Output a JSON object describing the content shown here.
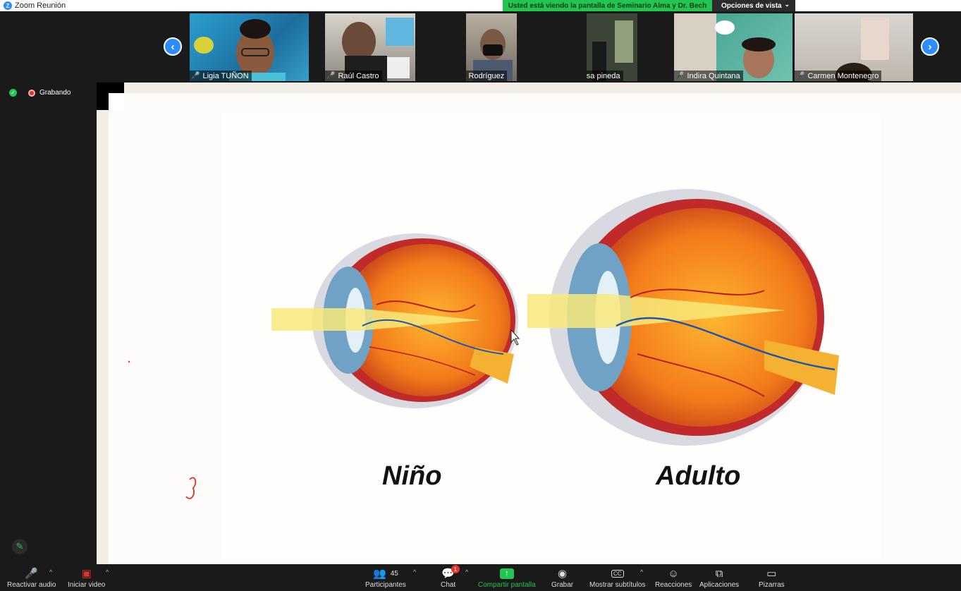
{
  "window": {
    "title": "Zoom Reunión"
  },
  "share_banner": {
    "text": "Usted está viendo la pantalla de Seminario Alma y Dr. Bech"
  },
  "view_options": {
    "label": "Opciones de vista"
  },
  "recording": {
    "label": "Grabando"
  },
  "participants": [
    {
      "name": "Ligia TUÑON"
    },
    {
      "name": "Raúl Castro"
    },
    {
      "name": "Eloisa Rodríguez"
    },
    {
      "name": "vanessa pineda"
    },
    {
      "name": "Indira Quintana"
    },
    {
      "name": "Carmen Montenegro"
    }
  ],
  "slide": {
    "label_left": "Niño",
    "label_right": "Adulto"
  },
  "toolbar": {
    "unmute": "Reactivar audio",
    "start_video": "Iniciar video",
    "participants": "Participantes",
    "participants_count": "45",
    "chat": "Chat",
    "chat_badge": "1",
    "share": "Compartir pantalla",
    "record": "Grabar",
    "captions": "Mostrar subtítulos",
    "reactions": "Reacciones",
    "apps": "Aplicaciones",
    "whiteboards": "Pizarras"
  },
  "colors": {
    "accent": "#2d8cff",
    "share_green": "#23c552",
    "muted_red": "#e0352b"
  }
}
